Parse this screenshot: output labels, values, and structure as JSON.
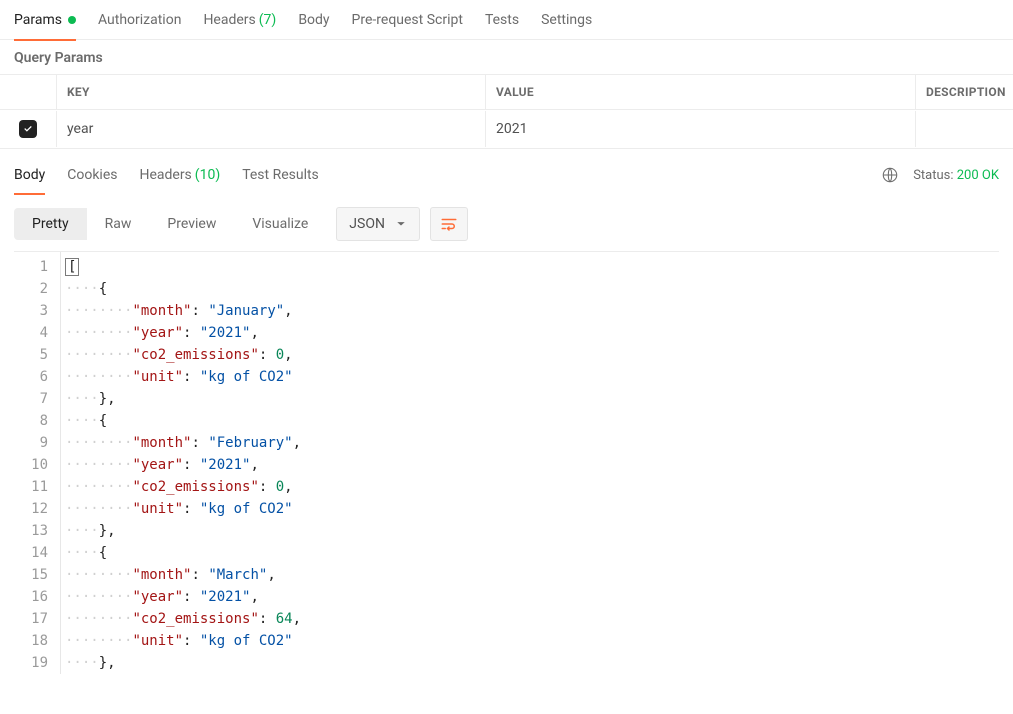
{
  "request_tabs": {
    "params": "Params",
    "authorization": "Authorization",
    "headers": "Headers",
    "headers_count": "(7)",
    "body": "Body",
    "pre_request": "Pre-request Script",
    "tests": "Tests",
    "settings": "Settings"
  },
  "section": {
    "query_params": "Query Params"
  },
  "params_table": {
    "key_header": "KEY",
    "value_header": "VALUE",
    "desc_header": "DESCRIPTION",
    "rows": [
      {
        "key": "year",
        "value": "2021"
      }
    ]
  },
  "response_tabs": {
    "body": "Body",
    "cookies": "Cookies",
    "headers": "Headers",
    "headers_count": "(10)",
    "test_results": "Test Results"
  },
  "status": {
    "label": "Status:",
    "value": "200 OK"
  },
  "view_modes": {
    "pretty": "Pretty",
    "raw": "Raw",
    "preview": "Preview",
    "visualize": "Visualize"
  },
  "format_select": {
    "value": "JSON"
  },
  "response_body": [
    {
      "month": "January",
      "year": "2021",
      "co2_emissions": 0,
      "unit": "kg of CO2"
    },
    {
      "month": "February",
      "year": "2021",
      "co2_emissions": 0,
      "unit": "kg of CO2"
    },
    {
      "month": "March",
      "year": "2021",
      "co2_emissions": 64,
      "unit": "kg of CO2"
    }
  ],
  "keys": {
    "month": "month",
    "year": "year",
    "co2": "co2_emissions",
    "unit": "unit"
  }
}
